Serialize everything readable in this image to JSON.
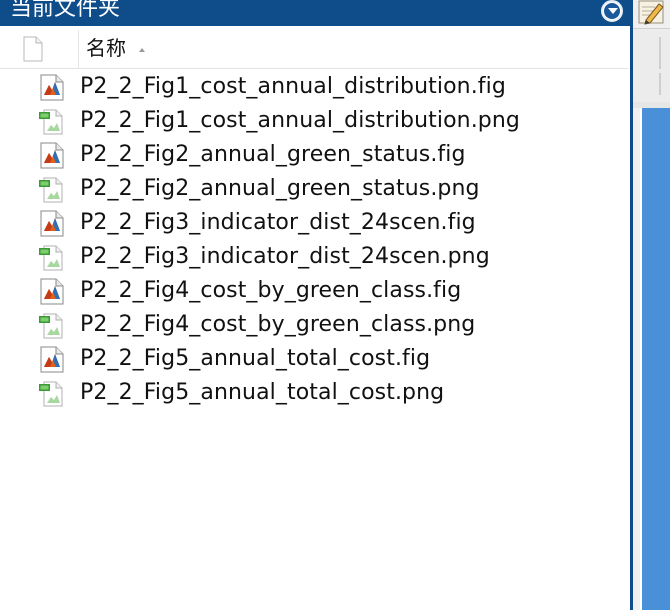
{
  "panel": {
    "title": "当前文件夹",
    "column_name": "名称"
  },
  "files": [
    {
      "name": "P2_2_Fig1_cost_annual_distribution.fig",
      "icon": "matlab-fig-icon"
    },
    {
      "name": "P2_2_Fig1_cost_annual_distribution.png",
      "icon": "png-image-icon"
    },
    {
      "name": "P2_2_Fig2_annual_green_status.fig",
      "icon": "matlab-fig-icon"
    },
    {
      "name": "P2_2_Fig2_annual_green_status.png",
      "icon": "png-image-icon"
    },
    {
      "name": "P2_2_Fig3_indicator_dist_24scen.fig",
      "icon": "matlab-fig-icon"
    },
    {
      "name": "P2_2_Fig3_indicator_dist_24scen.png",
      "icon": "png-image-icon"
    },
    {
      "name": "P2_2_Fig4_cost_by_green_class.fig",
      "icon": "matlab-fig-icon"
    },
    {
      "name": "P2_2_Fig4_cost_by_green_class.png",
      "icon": "png-image-icon"
    },
    {
      "name": "P2_2_Fig5_annual_total_cost.fig",
      "icon": "matlab-fig-icon"
    },
    {
      "name": "P2_2_Fig5_annual_total_cost.png",
      "icon": "png-image-icon"
    }
  ],
  "colors": {
    "titlebar": "#0f4c8a",
    "accent_blue": "#4a90d9"
  }
}
